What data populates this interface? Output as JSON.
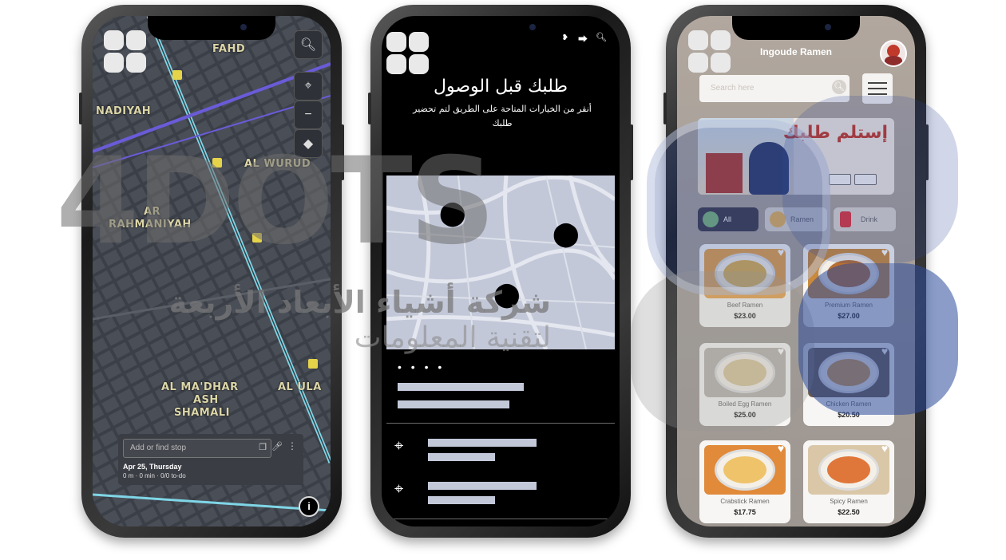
{
  "phone1": {
    "map_labels": [
      "FAHD",
      "NADIYAH",
      "AL WURUD",
      "AR",
      "RAHMANIYAH",
      "AL MA'DHAR",
      "ASH",
      "SHAMALI",
      "AL ULA"
    ],
    "stop_placeholder": "Add or find stop",
    "date": "Apr 25, Thursday",
    "summary": "0 m · 0 min · 0/0 to-do"
  },
  "phone2": {
    "title": "طلبك قبل الوصول",
    "subtitle": "أنقر من الخيارات المتاحة على الطريق لتم تحضير طلبك",
    "dots": "• • • •"
  },
  "phone3": {
    "header": "Ingoude Ramen",
    "search_placeholder": "Search here",
    "banner_title": "إستلم طلبك",
    "categories": [
      "All",
      "Ramen",
      "Drink"
    ],
    "items": [
      {
        "name": "Beef Ramen",
        "price": "$23.00"
      },
      {
        "name": "Premium Ramen",
        "price": "$27.00"
      },
      {
        "name": "Boiled Egg Ramen",
        "price": "$25.00"
      },
      {
        "name": "Chicken Ramen",
        "price": "$20.50"
      },
      {
        "name": "Crabstick Ramen",
        "price": "$17.75"
      },
      {
        "name": "Spicy Ramen",
        "price": "$22.50"
      }
    ]
  },
  "watermark": {
    "brand": "4DOTS",
    "arabic_line1": "شركة أشياء الأبعاد الأربعة",
    "arabic_line2": "لتقنية المعلومات"
  },
  "colors": {
    "map_bg": "#3b3f47",
    "road_cyan": "#7fd6e6",
    "road_purple": "#6a5bd8",
    "map_accent": "#c3c8d9",
    "banner_red": "#c0392b",
    "wm_blue": "#2c4a9a"
  }
}
